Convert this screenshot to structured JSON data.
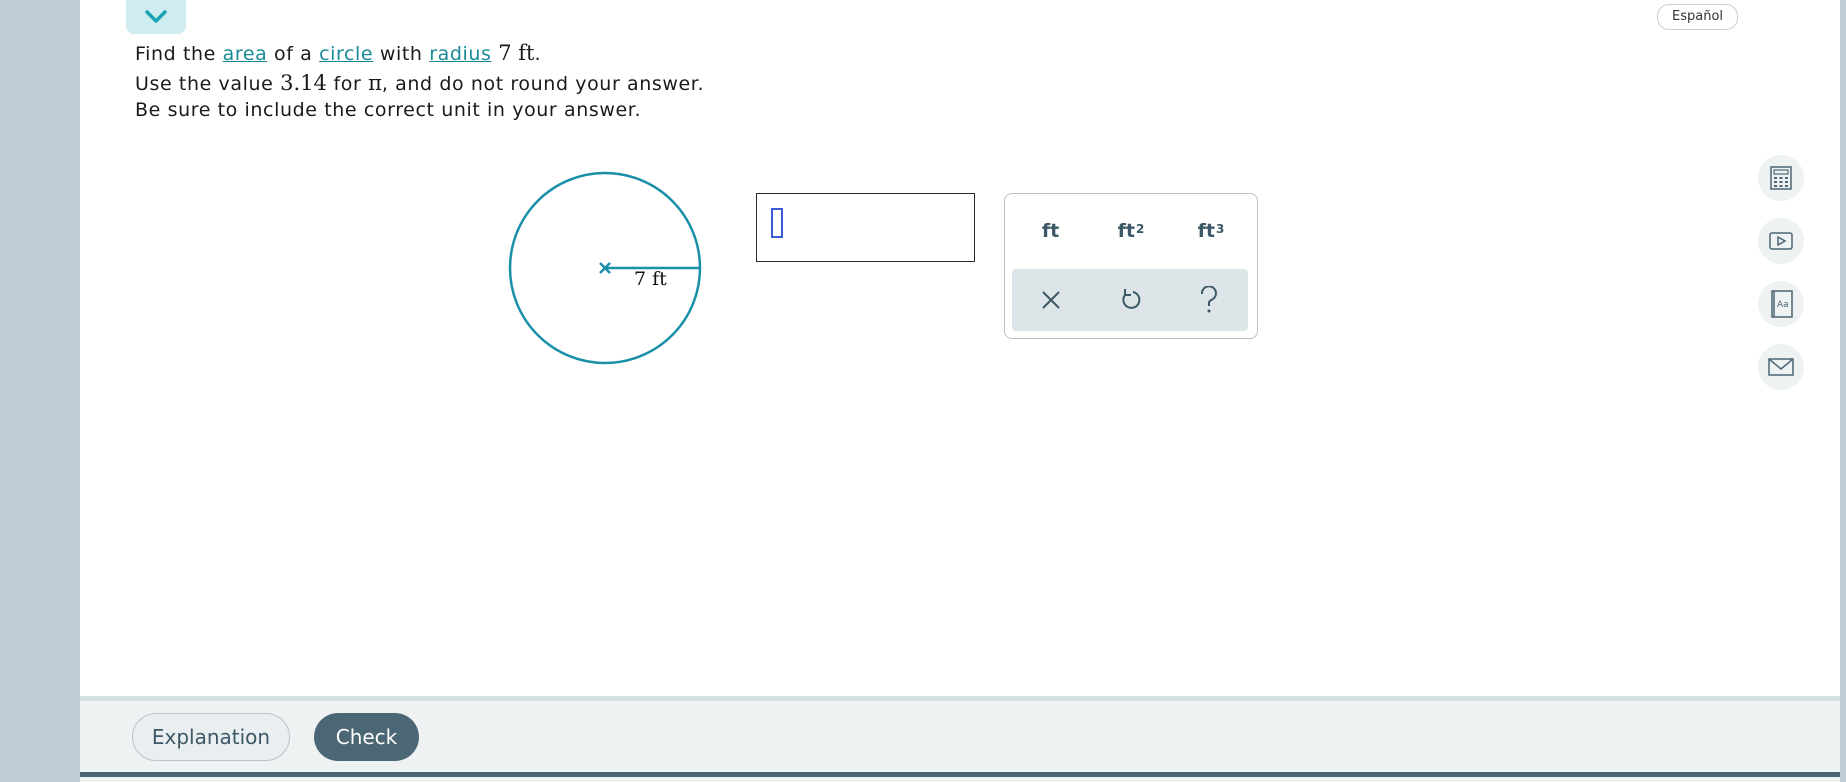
{
  "header": {
    "language_label": "Español"
  },
  "problem": {
    "line1": {
      "t1": "Find the ",
      "link_area": "area",
      "t2": " of a ",
      "link_circle": "circle",
      "t3": " with ",
      "link_radius": "radius",
      "t4": " ",
      "radius_value": "7 ft",
      "t5": "."
    },
    "line2": {
      "t1": "Use the value ",
      "pi_value": "3.14",
      "t2": " for ",
      "pi_symbol": "π",
      "t3": ", and do not round your answer."
    },
    "line3": "Be sure to include the correct unit in your answer."
  },
  "diagram": {
    "radius_label": "7 ft",
    "stroke_color": "#1a8fa8"
  },
  "answer": {
    "value": ""
  },
  "unit_panel": {
    "units": [
      {
        "base": "ft",
        "exp": ""
      },
      {
        "base": "ft",
        "exp": "2"
      },
      {
        "base": "ft",
        "exp": "3"
      }
    ],
    "actions": [
      "clear-icon",
      "undo-icon",
      "help-icon"
    ]
  },
  "tools": [
    "calculator-icon",
    "video-icon",
    "dictionary-icon",
    "message-icon"
  ],
  "footer": {
    "explanation_label": "Explanation",
    "check_label": "Check"
  }
}
